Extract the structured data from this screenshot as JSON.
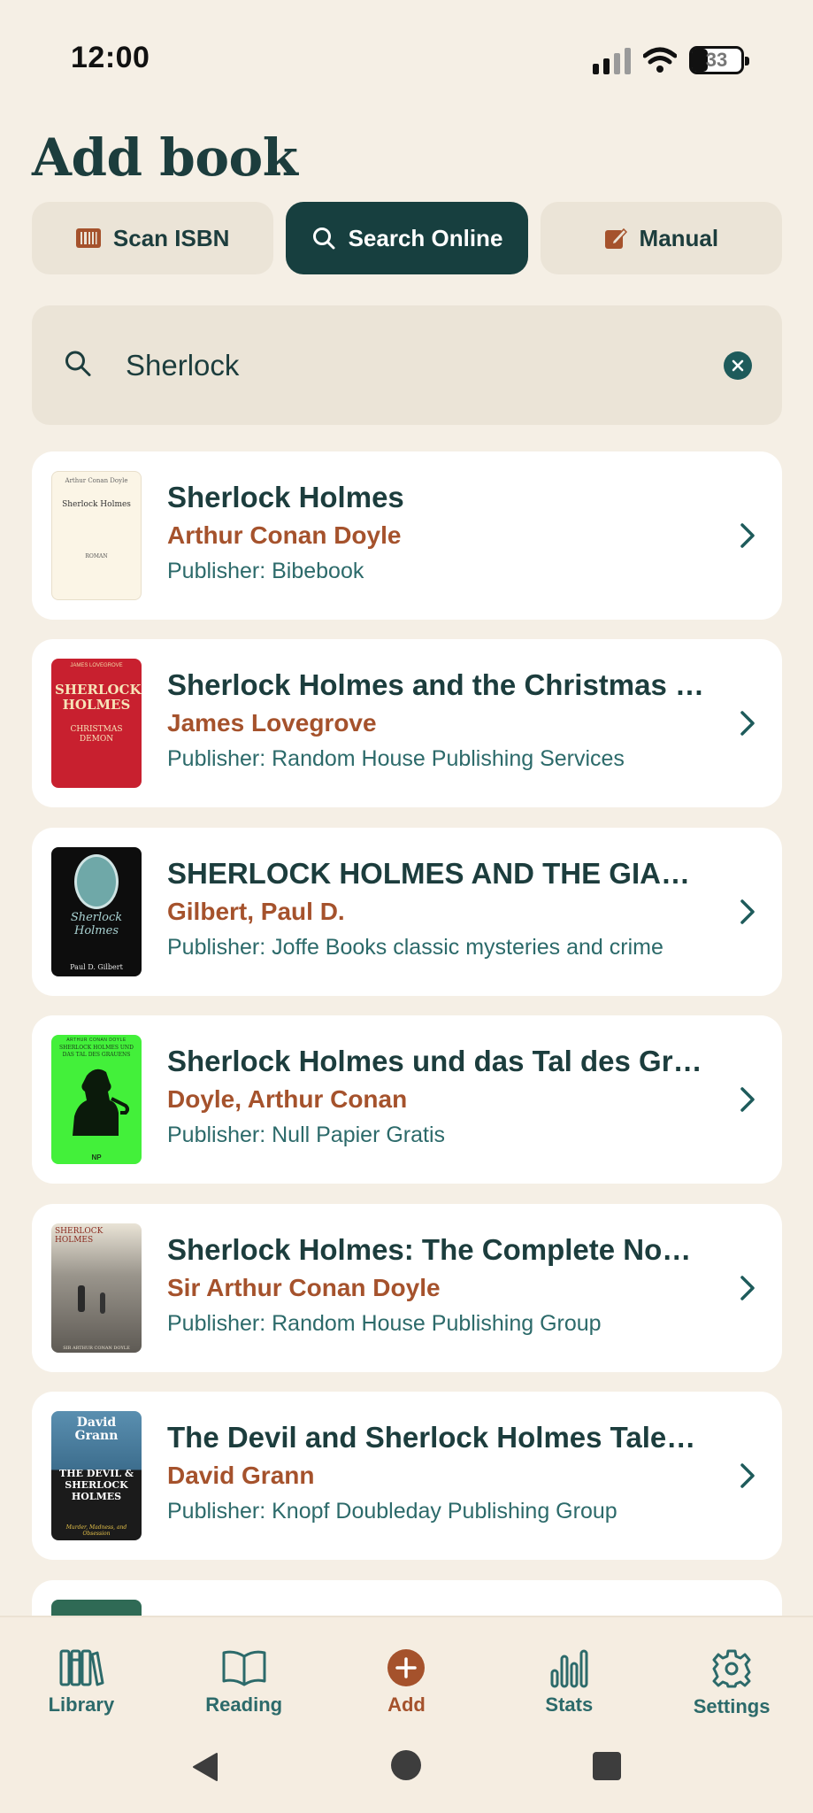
{
  "status_bar": {
    "time": "12:00",
    "battery": "33"
  },
  "page": {
    "title": "Add book"
  },
  "modes": [
    {
      "label": "Scan ISBN",
      "icon": "barcode-icon"
    },
    {
      "label": "Search Online",
      "icon": "search-icon"
    },
    {
      "label": "Manual",
      "icon": "edit-icon"
    }
  ],
  "search": {
    "value": "Sherlock"
  },
  "results": [
    {
      "title": "Sherlock Holmes",
      "author": "Arthur Conan Doyle",
      "publisher": "Publisher: Bibebook",
      "cover_top": "Arthur Conan Doyle",
      "cover_mid": "Sherlock Holmes",
      "cover_bottom": "ROMAN"
    },
    {
      "title": "Sherlock Holmes and the Christmas De...",
      "author": "James Lovegrove",
      "publisher": "Publisher: Random House Publishing Services",
      "cover_top": "JAMES LOVEGROVE",
      "cover_mid": "SHERLOCK HOLMES",
      "cover_bottom": "CHRISTMAS DEMON"
    },
    {
      "title": "SHERLOCK HOLMES AND THE GIANT R...",
      "author": "Gilbert, Paul D.",
      "publisher": "Publisher: Joffe Books classic mysteries and crime",
      "cover_top": "",
      "cover_mid": "Sherlock Holmes",
      "cover_bottom": "Paul D. Gilbert"
    },
    {
      "title": "Sherlock Holmes und das Tal des Graue...",
      "author": "Doyle, Arthur Conan",
      "publisher": "Publisher: Null Papier Gratis",
      "cover_top": "ARTHUR CONAN DOYLE",
      "cover_mid": "SHERLOCK HOLMES UND DAS TAL DES GRAUENS",
      "cover_bottom": "NP"
    },
    {
      "title": "Sherlock Holmes: The Complete Novels ...",
      "author": "Sir Arthur Conan Doyle",
      "publisher": "Publisher: Random House Publishing Group",
      "cover_top": "SHERLOCK HOLMES",
      "cover_mid": "",
      "cover_bottom": "SIR ARTHUR CONAN DOYLE"
    },
    {
      "title": "The Devil and Sherlock Holmes Tales of ...",
      "author": "David Grann",
      "publisher": "Publisher: Knopf Doubleday Publishing Group",
      "cover_top": "David Grann",
      "cover_mid": "THE DEVIL & SHERLOCK HOLMES",
      "cover_bottom": "Murder, Madness, and Obsession"
    }
  ],
  "bottom_nav": [
    {
      "label": "Library",
      "icon": "library-icon"
    },
    {
      "label": "Reading",
      "icon": "book-open-icon"
    },
    {
      "label": "Add",
      "icon": "add-circle-icon"
    },
    {
      "label": "Stats",
      "icon": "stats-icon"
    },
    {
      "label": "Settings",
      "icon": "gear-icon"
    }
  ],
  "colors": {
    "primary": "#173f3f",
    "accent": "#a5522c",
    "background": "#f5efe5",
    "chip": "#ebe4d7"
  }
}
